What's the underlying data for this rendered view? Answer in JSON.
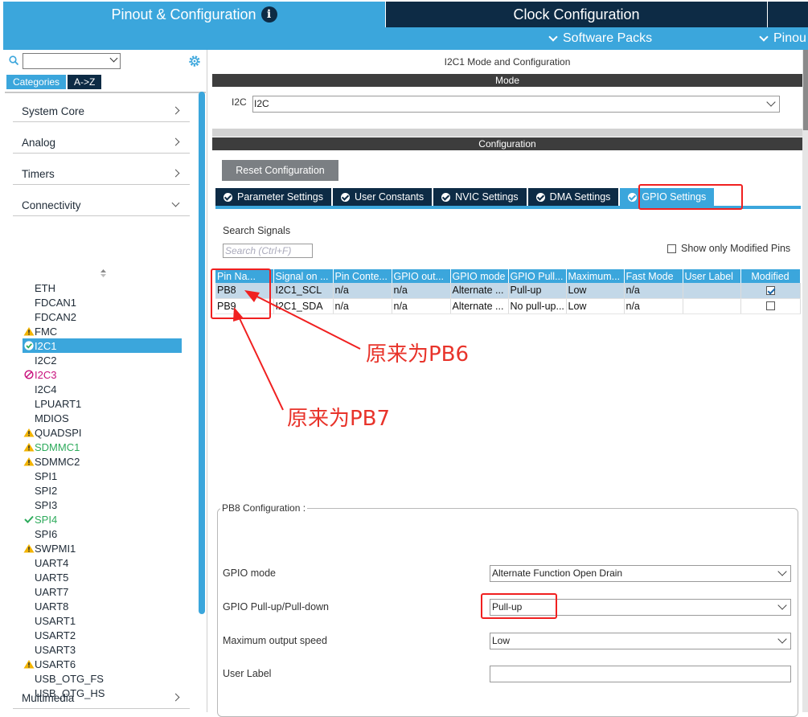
{
  "top_tabs": {
    "pinout": "Pinout & Configuration",
    "clock": "Clock Configuration"
  },
  "sub_bar": {
    "software_packs": "Software Packs",
    "pinout": "Pinou"
  },
  "left": {
    "cat_tabs": {
      "categories": "Categories",
      "az": "A->Z"
    },
    "categories": [
      {
        "label": "System Core"
      },
      {
        "label": "Analog"
      },
      {
        "label": "Timers"
      },
      {
        "label": "Connectivity"
      },
      {
        "label": "Multimedia"
      }
    ],
    "peripherals": [
      {
        "label": "ETH",
        "status": "none"
      },
      {
        "label": "FDCAN1",
        "status": "none"
      },
      {
        "label": "FDCAN2",
        "status": "none"
      },
      {
        "label": "FMC",
        "status": "warning"
      },
      {
        "label": "I2C1",
        "status": "ok-selected"
      },
      {
        "label": "I2C2",
        "status": "none"
      },
      {
        "label": "I2C3",
        "status": "disabled"
      },
      {
        "label": "I2C4",
        "status": "none"
      },
      {
        "label": "LPUART1",
        "status": "none"
      },
      {
        "label": "MDIOS",
        "status": "none"
      },
      {
        "label": "QUADSPI",
        "status": "warning"
      },
      {
        "label": "SDMMC1",
        "status": "warning-green"
      },
      {
        "label": "SDMMC2",
        "status": "warning"
      },
      {
        "label": "SPI1",
        "status": "none"
      },
      {
        "label": "SPI2",
        "status": "none"
      },
      {
        "label": "SPI3",
        "status": "none"
      },
      {
        "label": "SPI4",
        "status": "ok"
      },
      {
        "label": "SPI6",
        "status": "none"
      },
      {
        "label": "SWPMI1",
        "status": "warning"
      },
      {
        "label": "UART4",
        "status": "none"
      },
      {
        "label": "UART5",
        "status": "none"
      },
      {
        "label": "UART7",
        "status": "none"
      },
      {
        "label": "UART8",
        "status": "none"
      },
      {
        "label": "USART1",
        "status": "none"
      },
      {
        "label": "USART2",
        "status": "none"
      },
      {
        "label": "USART3",
        "status": "none"
      },
      {
        "label": "USART6",
        "status": "warning"
      },
      {
        "label": "USB_OTG_FS",
        "status": "none"
      },
      {
        "label": "USB_OTG_HS",
        "status": "none"
      }
    ]
  },
  "right": {
    "title": "I2C1 Mode and Configuration",
    "mode_bar": "Mode",
    "i2c_label": "I2C",
    "i2c_value": "I2C",
    "config_bar": "Configuration",
    "reset_button": "Reset Configuration",
    "tabs": [
      {
        "label": "Parameter Settings",
        "active": false
      },
      {
        "label": "User Constants",
        "active": false
      },
      {
        "label": "NVIC Settings",
        "active": false
      },
      {
        "label": "DMA Settings",
        "active": false
      },
      {
        "label": "GPIO Settings",
        "active": true
      }
    ],
    "search_signals_label": "Search Signals",
    "search_signals_placeholder": "Search (Ctrl+F)",
    "show_only_modified": "Show only Modified Pins",
    "table": {
      "headers": [
        "Pin Na...",
        "Signal on ...",
        "Pin Conte...",
        "GPIO out...",
        "GPIO mode",
        "GPIO Pull...",
        "Maximum...",
        "Fast Mode",
        "User Label",
        "Modified"
      ],
      "rows": [
        {
          "pin": "PB8",
          "signal": "I2C1_SCL",
          "context": "n/a",
          "output": "n/a",
          "mode": "Alternate ...",
          "pull": "Pull-up",
          "speed": "Low",
          "fast": "n/a",
          "label": "",
          "modified": true
        },
        {
          "pin": "PB9",
          "signal": "I2C1_SDA",
          "context": "n/a",
          "output": "n/a",
          "mode": "Alternate ...",
          "pull": "No pull-up...",
          "speed": "Low",
          "fast": "n/a",
          "label": "",
          "modified": false
        }
      ]
    },
    "pb8_config": {
      "title": "PB8 Configuration :",
      "gpio_mode_label": "GPIO mode",
      "gpio_mode_value": "Alternate Function Open Drain",
      "pull_label": "GPIO Pull-up/Pull-down",
      "pull_value": "Pull-up",
      "speed_label": "Maximum output speed",
      "speed_value": "Low",
      "user_label_label": "User Label",
      "user_label_value": ""
    }
  },
  "annotations": {
    "pb6_note": "原来为PB6",
    "pb7_note": "原来为PB7",
    "color": "#e8332a"
  },
  "colors": {
    "accent": "#3ba6dc",
    "dark": "#0d2b45",
    "annotation": "#f02020"
  }
}
